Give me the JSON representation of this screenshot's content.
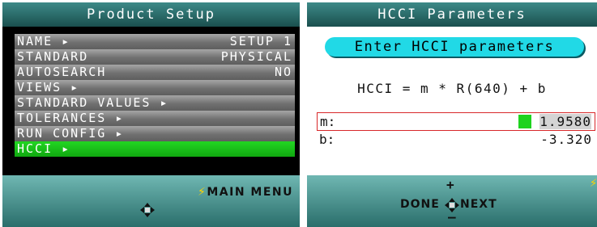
{
  "left_panel": {
    "title": "Product Setup",
    "menu": [
      {
        "label": "NAME ▸",
        "value": "SETUP 1"
      },
      {
        "label": "STANDARD",
        "value": "PHYSICAL"
      },
      {
        "label": "AUTOSEARCH",
        "value": "NO"
      },
      {
        "label": "VIEWS ▸",
        "value": ""
      },
      {
        "label": "STANDARD VALUES ▸",
        "value": ""
      },
      {
        "label": "TOLERANCES ▸",
        "value": ""
      },
      {
        "label": "RUN CONFIG ▸",
        "value": ""
      },
      {
        "label": "HCCI ▸",
        "value": ""
      }
    ],
    "selected_index": 7,
    "footer_label": "MAIN MENU",
    "footer_icon": "lightning-bolt-icon"
  },
  "right_panel": {
    "title": "HCCI Parameters",
    "prompt": "Enter HCCI parameters",
    "formula": "HCCI = m * R(640) + b",
    "fields": {
      "m_label": "m:",
      "m_value": "1.9580",
      "b_label": "b:",
      "b_value": "-3.320"
    },
    "footer": {
      "done_label": "DONE",
      "next_label": "NEXT",
      "plus": "+",
      "minus": "–"
    }
  },
  "colors": {
    "title_bar": "#2a6a68",
    "footer": "#4f9a96",
    "selected": "#18c418",
    "pill": "#21d9e6",
    "field_border": "#d8282a"
  }
}
